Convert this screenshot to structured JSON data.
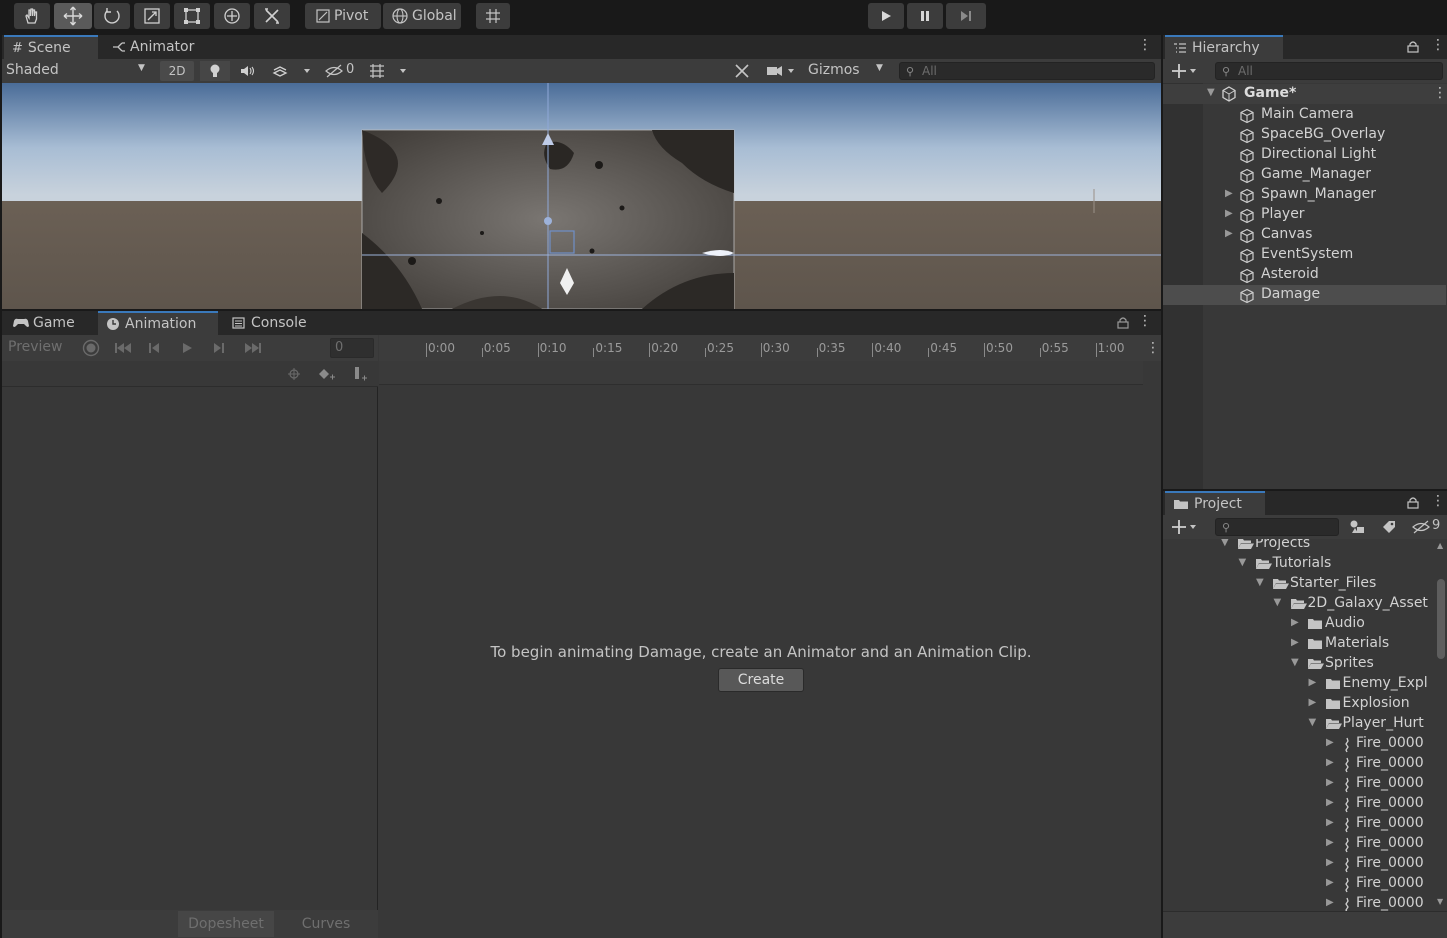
{
  "toolbar": {
    "tools": [
      "hand-tool",
      "move-tool",
      "rotate-tool",
      "scale-tool",
      "rect-tool",
      "transform-tool",
      "custom-tool"
    ],
    "pivot_label": "Pivot",
    "global_label": "Global"
  },
  "scene": {
    "tabs": [
      {
        "label": "Scene"
      },
      {
        "label": "Animator"
      }
    ],
    "shading_mode": "Shaded",
    "mode_2d": "2D",
    "hidden_count": "0",
    "gizmos_label": "Gizmos",
    "search_placeholder": "All"
  },
  "animation_window": {
    "tabs": [
      {
        "label": "Game"
      },
      {
        "label": "Animation"
      },
      {
        "label": "Console"
      }
    ],
    "preview_label": "Preview",
    "frame_value": "0",
    "ruler_labels": [
      "0:00",
      "0:05",
      "0:10",
      "0:15",
      "0:20",
      "0:25",
      "0:30",
      "0:35",
      "0:40",
      "0:45",
      "0:50",
      "0:55",
      "1:00"
    ],
    "message": "To begin animating Damage, create an Animator and an Animation Clip.",
    "create_label": "Create",
    "bottom_tabs": [
      "Dopesheet",
      "Curves"
    ]
  },
  "hierarchy": {
    "title": "Hierarchy",
    "search_placeholder": "All",
    "scene_name": "Game*",
    "items": [
      {
        "label": "Main Camera",
        "expandable": false
      },
      {
        "label": "SpaceBG_Overlay",
        "expandable": false
      },
      {
        "label": "Directional Light",
        "expandable": false
      },
      {
        "label": "Game_Manager",
        "expandable": false
      },
      {
        "label": "Spawn_Manager",
        "expandable": true
      },
      {
        "label": "Player",
        "expandable": true
      },
      {
        "label": "Canvas",
        "expandable": true
      },
      {
        "label": "EventSystem",
        "expandable": false
      },
      {
        "label": "Asteroid",
        "expandable": false
      },
      {
        "label": "Damage",
        "expandable": false,
        "selected": true
      }
    ]
  },
  "project": {
    "title": "Project",
    "hidden_count": "9",
    "tree": [
      {
        "label": "Projects",
        "depth": 0,
        "open": true,
        "type": "folder"
      },
      {
        "label": "Tutorials",
        "depth": 1,
        "open": true,
        "type": "folder"
      },
      {
        "label": "Starter_Files",
        "depth": 2,
        "open": true,
        "type": "folder"
      },
      {
        "label": "2D_Galaxy_Asset",
        "depth": 3,
        "open": true,
        "type": "folder"
      },
      {
        "label": "Audio",
        "depth": 4,
        "open": false,
        "type": "folder"
      },
      {
        "label": "Materials",
        "depth": 4,
        "open": false,
        "type": "folder"
      },
      {
        "label": "Sprites",
        "depth": 4,
        "open": true,
        "type": "folder"
      },
      {
        "label": "Enemy_Expl",
        "depth": 5,
        "open": false,
        "type": "folder"
      },
      {
        "label": "Explosion",
        "depth": 5,
        "open": false,
        "type": "folder"
      },
      {
        "label": "Player_Hurt",
        "depth": 5,
        "open": true,
        "type": "folder"
      },
      {
        "label": "Fire_0000",
        "depth": 6,
        "open": false,
        "type": "sprite"
      },
      {
        "label": "Fire_0000",
        "depth": 6,
        "open": false,
        "type": "sprite"
      },
      {
        "label": "Fire_0000",
        "depth": 6,
        "open": false,
        "type": "sprite"
      },
      {
        "label": "Fire_0000",
        "depth": 6,
        "open": false,
        "type": "sprite"
      },
      {
        "label": "Fire_0000",
        "depth": 6,
        "open": false,
        "type": "sprite"
      },
      {
        "label": "Fire_0000",
        "depth": 6,
        "open": false,
        "type": "sprite"
      },
      {
        "label": "Fire_0000",
        "depth": 6,
        "open": false,
        "type": "sprite"
      },
      {
        "label": "Fire_0000",
        "depth": 6,
        "open": false,
        "type": "sprite"
      },
      {
        "label": "Fire_0000",
        "depth": 6,
        "open": false,
        "type": "sprite"
      }
    ]
  },
  "colors": {
    "accent": "#3a79bb",
    "panel": "#383838",
    "dark": "#191919",
    "selection": "#4d4d4d"
  }
}
